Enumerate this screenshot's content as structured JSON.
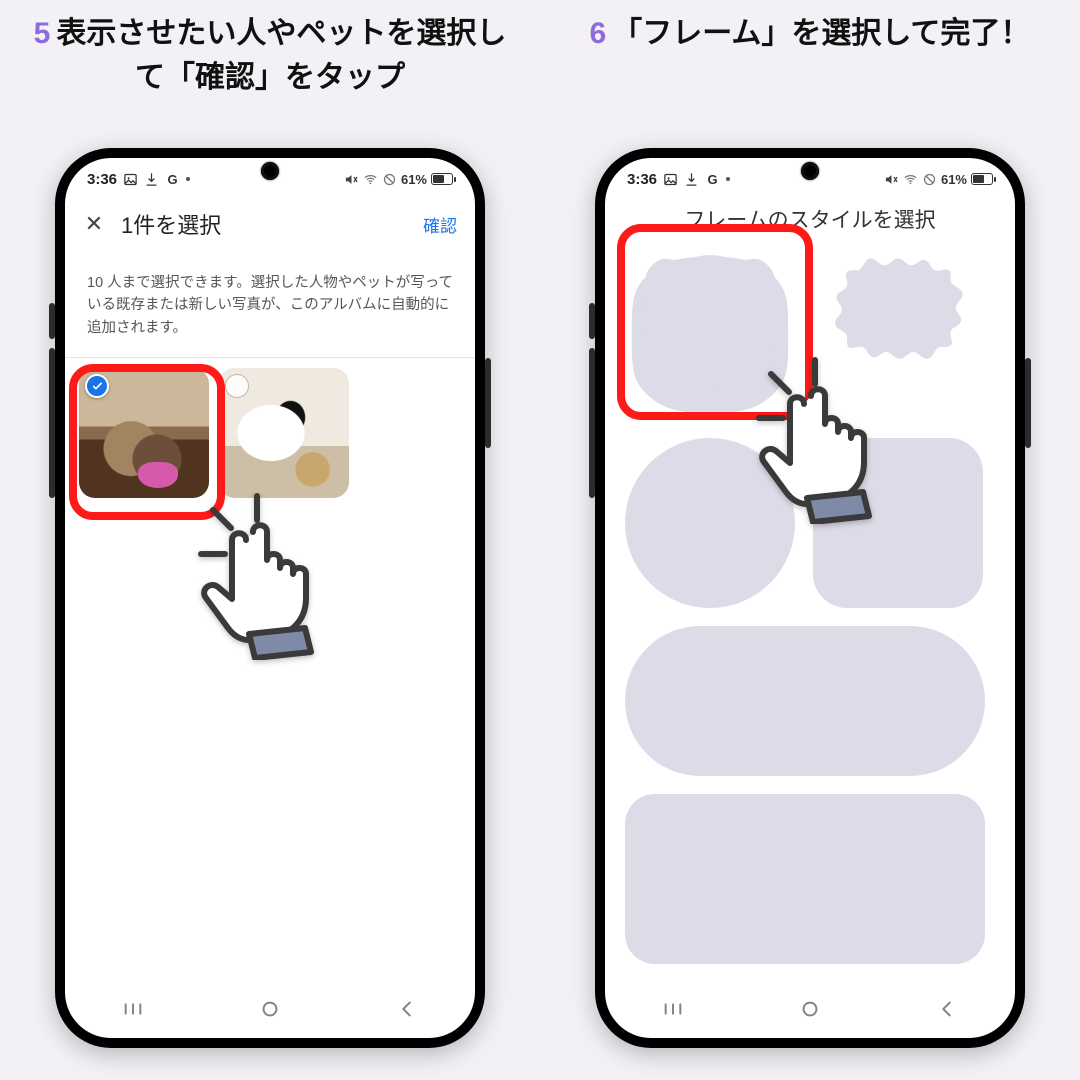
{
  "step5": {
    "number": "5",
    "heading": "表示させたい人やペットを選択して「確認」をタップ"
  },
  "step6": {
    "number": "6",
    "heading": "「フレーム」を選択して完了！"
  },
  "status": {
    "time": "3:36",
    "battery_pct": "61%"
  },
  "screen1": {
    "close_glyph": "✕",
    "title": "1件を選択",
    "confirm": "確認",
    "description": "10 人まで選択できます。選択した人物やペットが写っている既存または新しい写真が、このアルバムに自動的に追加されます。"
  },
  "screen2": {
    "title": "フレームのスタイルを選択"
  }
}
